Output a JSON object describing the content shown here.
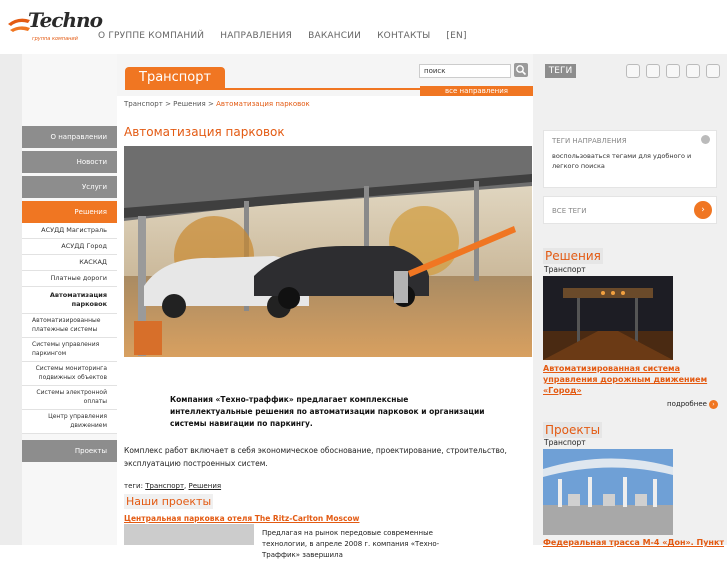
{
  "logo": {
    "text": "Techno",
    "tagline": "группа компаний"
  },
  "topnav": [
    "О ГРУППЕ КОМПАНИЙ",
    "НАПРАВЛЕНИЯ",
    "ВАКАНСИИ",
    "КОНТАКТЫ",
    "[EN]"
  ],
  "header": {
    "section": "Транспорт",
    "search_value": "поиск",
    "all_directions": "все направления",
    "tags_label": "ТЕГИ"
  },
  "breadcrumb": {
    "b1": "Транспорт",
    "sep": ">",
    "b2": "Решения",
    "b3": "Автоматизация парковок"
  },
  "sidenav": {
    "about": "О направлении",
    "news": "Новости",
    "services": "Услуги",
    "solutions": "Решения",
    "sub": [
      "АСУДД Магистраль",
      "АСУДД Город",
      "КАСКАД",
      "Платные дороги",
      "Автоматизация парковок"
    ],
    "sub2": [
      "Автоматизированные платежные системы",
      "Системы управления паркингом"
    ],
    "sub3": [
      "Системы мониторинга подвижных объектов",
      "Системы электронной оплаты",
      "Центр управления движением"
    ],
    "projects": "Проекты"
  },
  "main": {
    "title": "Автоматизация парковок",
    "lead": "Компания «Техно-траффик» предлагает комплексные интеллектуальные решения по автоматизации парковок и организации системы навигации по паркингу.",
    "para": "Комплекс работ включает в себя экономическое обоснование, проектирование, строительство, эксплуатацию построенных систем.",
    "tags_prefix": "теги:",
    "tag1": "Транспорт",
    "tag2": "Решения",
    "projects_heading": "Наши проекты",
    "project_link": "Центральная парковка отеля The Ritz-Carlton Moscow",
    "project_text": "Предлагая на рынок передовые современные технологии, в апреле 2008 г. компания «Техно-Траффик» завершила"
  },
  "right": {
    "tagbox_heading": "ТЕГИ НАПРАВЛЕНИЯ",
    "tagbox_text": "воспользоваться тегами для удобного и легкого поиска",
    "all_tags": "ВСЕ ТЕГИ",
    "solutions_heading": "Решения",
    "solutions_sub": "Транспорт",
    "solutions_link": "Автоматизированная система управления дорожным движением «Город»",
    "more": "подробнее",
    "projects_heading": "Проекты",
    "projects_sub": "Транспорт",
    "projects_link": "Федеральная трасса М-4 «Дон». Пункт"
  },
  "colors": {
    "accent": "#f07622",
    "grey": "#8d8d8d"
  }
}
